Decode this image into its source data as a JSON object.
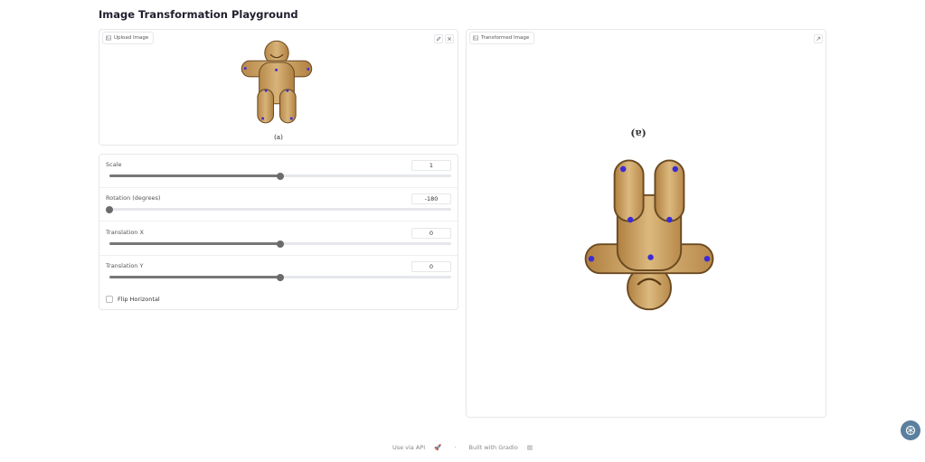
{
  "page": {
    "title": "Image Transformation Playground"
  },
  "upload_panel": {
    "label": "Upload Image",
    "caption": "(a)",
    "buttons": [
      "edit-icon",
      "close-icon"
    ]
  },
  "output_panel": {
    "label": "Transformed Image",
    "caption": "(a)",
    "buttons": [
      "share-icon"
    ]
  },
  "controls": {
    "scale": {
      "label": "Scale",
      "value": "1",
      "fraction": 0.5
    },
    "rotation": {
      "label": "Rotation (degrees)",
      "value": "-180",
      "fraction": 0.0
    },
    "translation_x": {
      "label": "Translation X",
      "value": "0",
      "fraction": 0.5
    },
    "translation_y": {
      "label": "Translation Y",
      "value": "0",
      "fraction": 0.5
    },
    "flip_horizontal": {
      "label": "Flip Horizontal",
      "checked": false
    }
  },
  "footer": {
    "api": "Use via API",
    "built": "Built with Gradio"
  },
  "colors": {
    "wood": "#c49a5a",
    "keypoint": "#3a2bd6",
    "accent": "#5b7f9e"
  }
}
